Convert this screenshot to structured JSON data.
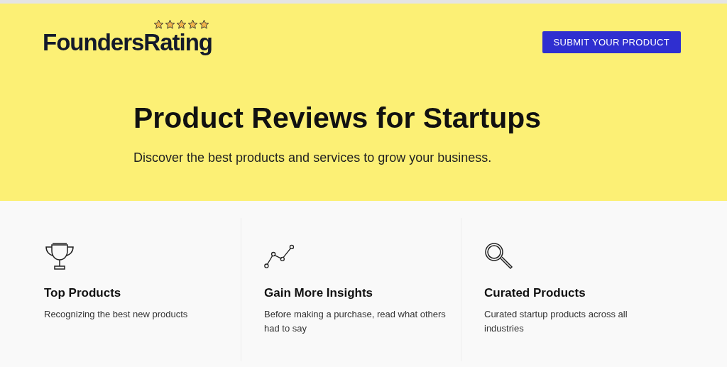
{
  "header": {
    "logo": {
      "text": "FoundersRating",
      "stars": 5
    },
    "button": "SUBMIT YOUR PRODUCT"
  },
  "hero": {
    "title": "Product Reviews for Startups",
    "subtitle": "Discover the best products and services to grow your business."
  },
  "features": [
    {
      "kind": "trophy",
      "title": "Top Products",
      "text": "Recognizing the best new products"
    },
    {
      "kind": "chart",
      "title": "Gain More Insights",
      "text": "Before making a purchase, read what others had to say"
    },
    {
      "kind": "search",
      "title": "Curated Products",
      "text": "Curated startup products across all industries"
    }
  ]
}
